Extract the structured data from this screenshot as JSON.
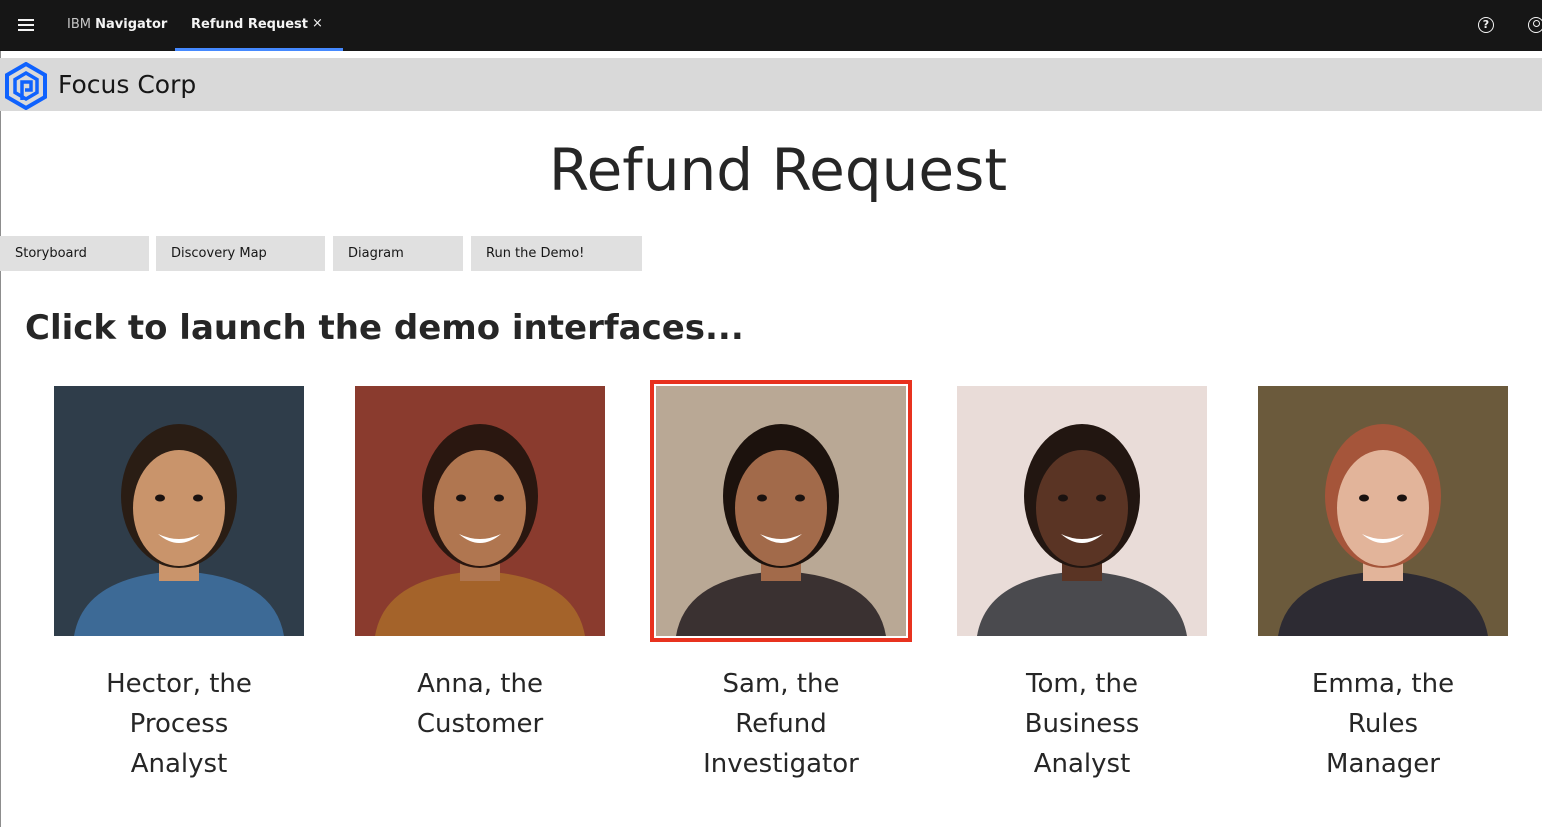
{
  "topbar": {
    "brand_prefix": "IBM",
    "brand_name": "Navigator",
    "active_tab": "Refund Request",
    "close_glyph": "×",
    "help_glyph": "?"
  },
  "company": {
    "name": "Focus Corp",
    "logo_color": "#0f62fe"
  },
  "page": {
    "title": "Refund Request",
    "section_heading": "Click to launch the demo interfaces..."
  },
  "nav_buttons": [
    {
      "label": "Storyboard"
    },
    {
      "label": "Discovery Map"
    },
    {
      "label": "Diagram"
    },
    {
      "label": "Run the Demo!"
    }
  ],
  "personas": [
    {
      "line1": "Hector, the",
      "line2": "Process",
      "line3": "Analyst",
      "selected": false,
      "bg": "#2f3d4a",
      "skin": "#c9946b",
      "hair": "#2a1d14",
      "shirt": "#3d6a96"
    },
    {
      "line1": "Anna, the",
      "line2": "Customer",
      "line3": "",
      "selected": false,
      "bg": "#8a3b2e",
      "skin": "#b07650",
      "hair": "#2a1710",
      "shirt": "#a4632a"
    },
    {
      "line1": "Sam, the",
      "line2": "Refund",
      "line3": "Investigator",
      "selected": true,
      "bg": "#b9a895",
      "skin": "#a26a4a",
      "hair": "#1c120d",
      "shirt": "#3a3131"
    },
    {
      "line1": "Tom, the",
      "line2": "Business",
      "line3": "Analyst",
      "selected": false,
      "bg": "#e9dcd8",
      "skin": "#5a3424",
      "hair": "#221611",
      "shirt": "#4a4a4e"
    },
    {
      "line1": "Emma, the",
      "line2": "Rules",
      "line3": "Manager",
      "selected": false,
      "bg": "#6b5a3c",
      "skin": "#e2b49a",
      "hair": "#a5553a",
      "shirt": "#2d2b33"
    }
  ]
}
